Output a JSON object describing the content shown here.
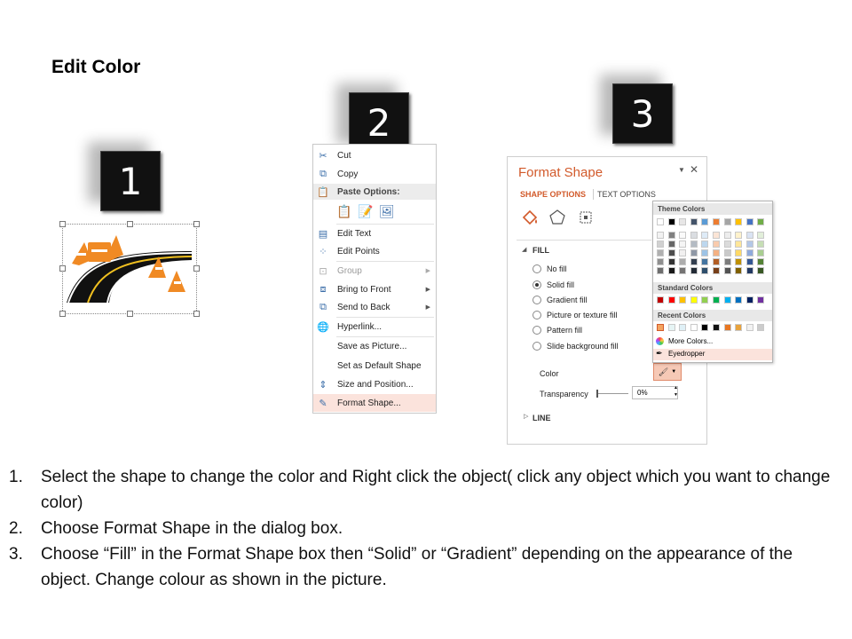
{
  "title": "Edit Color",
  "badges": [
    "1",
    "2",
    "3"
  ],
  "context_menu": {
    "items": [
      {
        "icon": "scissors-icon",
        "label": "Cut"
      },
      {
        "icon": "copy-icon",
        "label": "Copy"
      },
      {
        "icon": "paste-icon",
        "label": "Paste Options:"
      },
      {
        "icon": "edit-text-icon",
        "label": "Edit Text"
      },
      {
        "icon": "edit-points-icon",
        "label": "Edit Points"
      },
      {
        "icon": "group-icon",
        "label": "Group"
      },
      {
        "icon": "bring-to-front-icon",
        "label": "Bring to Front"
      },
      {
        "icon": "send-to-back-icon",
        "label": "Send to Back"
      },
      {
        "icon": "hyperlink-icon",
        "label": "Hyperlink..."
      },
      {
        "icon": "",
        "label": "Save as Picture..."
      },
      {
        "icon": "",
        "label": "Set as Default Shape"
      },
      {
        "icon": "size-position-icon",
        "label": "Size and Position..."
      },
      {
        "icon": "format-shape-icon",
        "label": "Format Shape..."
      }
    ]
  },
  "format_pane": {
    "title": "Format Shape",
    "tabs": [
      "SHAPE OPTIONS",
      "TEXT OPTIONS"
    ],
    "fill_header": "FILL",
    "fill_options": [
      {
        "label": "No fill",
        "selected": false
      },
      {
        "label": "Solid fill",
        "selected": true
      },
      {
        "label": "Gradient fill",
        "selected": false
      },
      {
        "label": "Picture or texture fill",
        "selected": false
      },
      {
        "label": "Pattern fill",
        "selected": false
      },
      {
        "label": "Slide background fill",
        "selected": false
      }
    ],
    "color_label": "Color",
    "transparency_label": "Transparency",
    "transparency_value": "0%",
    "line_header": "LINE"
  },
  "color_popup": {
    "theme_header": "Theme Colors",
    "standard_header": "Standard Colors",
    "recent_header": "Recent Colors",
    "more_colors": "More Colors...",
    "eyedropper": "Eyedropper",
    "theme_colors": [
      "#ffffff",
      "#000000",
      "#e7e6e6",
      "#44546a",
      "#5b9bd5",
      "#ed7d31",
      "#a5a5a5",
      "#ffc000",
      "#4472c4",
      "#70ad47"
    ],
    "standard_colors": [
      "#c00000",
      "#ff0000",
      "#ffc000",
      "#ffff00",
      "#92d050",
      "#00b050",
      "#00b0f0",
      "#0070c0",
      "#002060",
      "#7030a0"
    ],
    "recent_colors": [
      "#f4a460",
      "#e6f4f4",
      "#dff0f6",
      "#ffffff",
      "#000000",
      "#111111",
      "#e87722",
      "#e8a33d",
      "#f2f2f2",
      "#cccccc"
    ]
  },
  "instructions": [
    {
      "num": "1.",
      "text": "Select the shape to change the color and Right click the object( click any object which you want to change color)"
    },
    {
      "num": "2.",
      "text": "Choose Format Shape in the dialog box."
    },
    {
      "num": "3.",
      "text": "Choose “Fill” in the Format Shape box then “Solid” or “Gradient” depending on the appearance of the object. Change colour as shown in the picture."
    }
  ]
}
